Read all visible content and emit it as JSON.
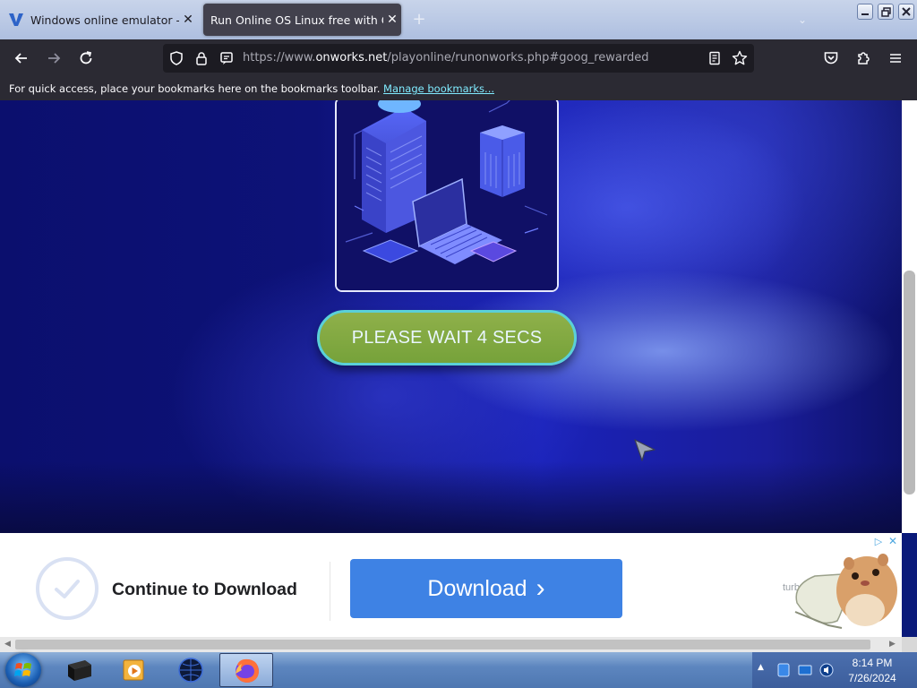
{
  "browser": {
    "tabs": [
      {
        "label": "Windows online emulator - OnW",
        "close": "✕"
      },
      {
        "label": "Run Online OS Linux free with OnWorks",
        "close": "✕"
      }
    ],
    "new_tab": "+",
    "url": {
      "prefix": "https://www.",
      "domain": "onworks.net",
      "path": "/playonline/runonworks.php#goog_rewarded"
    },
    "bookmarks_text": "For quick access, place your bookmarks here on the bookmarks toolbar.",
    "bookmarks_link": "Manage bookmarks..."
  },
  "page": {
    "wait_button": "PLEASE WAIT 4 SECS"
  },
  "ad": {
    "title": "Continue to Download",
    "button": "Download",
    "button_chevron": "›",
    "brand": "turbo",
    "choices": "▷",
    "close": "✕"
  },
  "taskbar": {
    "time": "8:14 PM",
    "date": "7/26/2024"
  },
  "colors": {
    "download_button": "#3e82e4",
    "wait_button": "#8fb04a",
    "wait_button_border": "#5ad0d8",
    "browser_chrome": "#2b2a33",
    "link": "#80ebff"
  },
  "icons": [
    "onworks-favicon",
    "shield-icon",
    "lock-icon",
    "permissions-icon",
    "reader-view-icon",
    "bookmark-star-icon",
    "pocket-icon",
    "extensions-icon",
    "hamburger-menu-icon",
    "back-arrow-icon",
    "forward-arrow-icon",
    "reload-icon"
  ]
}
